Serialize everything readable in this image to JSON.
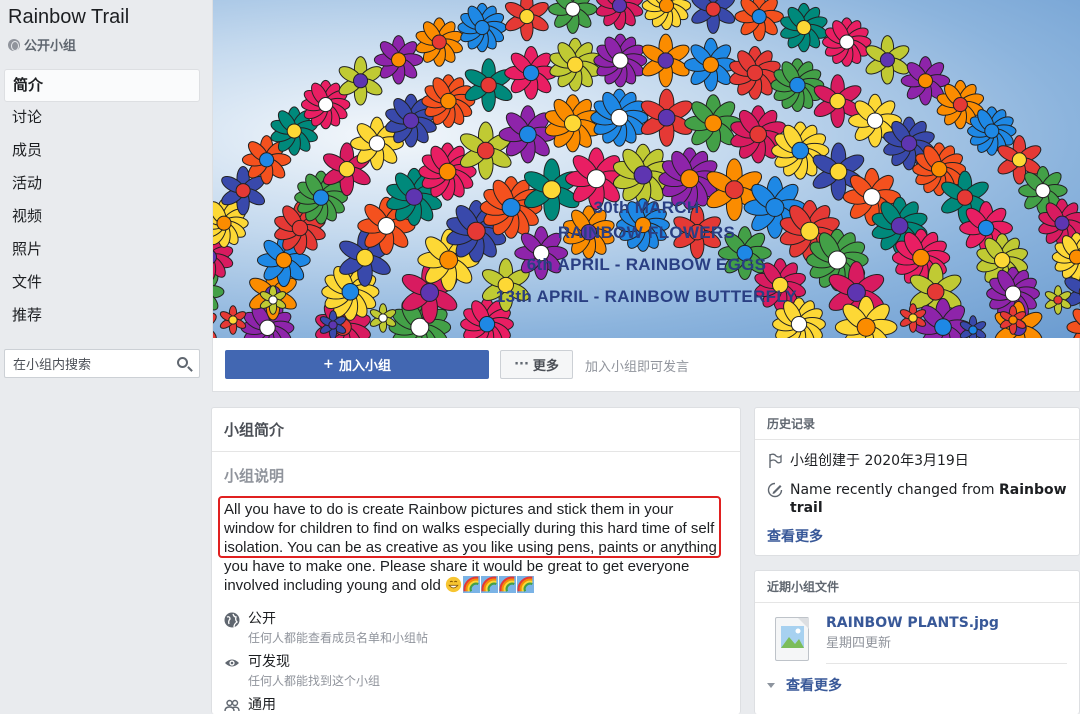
{
  "group": {
    "title": "Rainbow Trail",
    "privacy": "公开小组"
  },
  "nav": [
    {
      "label": "简介",
      "active": true
    },
    {
      "label": "讨论"
    },
    {
      "label": "成员"
    },
    {
      "label": "活动"
    },
    {
      "label": "视频"
    },
    {
      "label": "照片"
    },
    {
      "label": "文件"
    },
    {
      "label": "推荐"
    }
  ],
  "search": {
    "placeholder": "在小组内搜索"
  },
  "cover": {
    "lines": [
      "30th MARCH",
      "RAINBOW FLOWERS",
      "6th APRIL - RAINBOW EGGS",
      "13th APRIL - RAINBOW BUTTERFLY"
    ]
  },
  "actions": {
    "join_label": "加入小组",
    "join_prefix": "+",
    "more_label": "更多",
    "more_prefix": "···",
    "hint": "加入小组即可发言"
  },
  "about": {
    "title": "小组简介",
    "subtitle": "小组说明",
    "description": "All you have to do is create Rainbow pictures and stick them in your window for children to find on walks especially during this hard time of self isolation. You can be as creative as you like using pens, paints or anything you have to make one. Please share it would be great to get everyone involved including young and old",
    "info": [
      {
        "title": "公开",
        "sub": "任何人都能查看成员名单和小组帖",
        "icon": "globe-icon"
      },
      {
        "title": "可发现",
        "sub": "任何人都能找到这个小组",
        "icon": "eye-icon"
      },
      {
        "title": "通用",
        "sub": "",
        "icon": "people-icon"
      }
    ]
  },
  "history": {
    "title": "历史记录",
    "created": "小组创建于 2020年3月19日",
    "renamed_prefix": "Name recently changed from ",
    "renamed_name": "Rainbow trail",
    "see_more": "查看更多"
  },
  "files": {
    "title": "近期小组文件",
    "name": "RAINBOW PLANTS.jpg",
    "updated": "星期四更新",
    "see_more": "查看更多"
  },
  "colors": {
    "brand": "#4267b2",
    "link": "#385898",
    "background": "#e9ebee",
    "highlight_border": "#e02020"
  }
}
